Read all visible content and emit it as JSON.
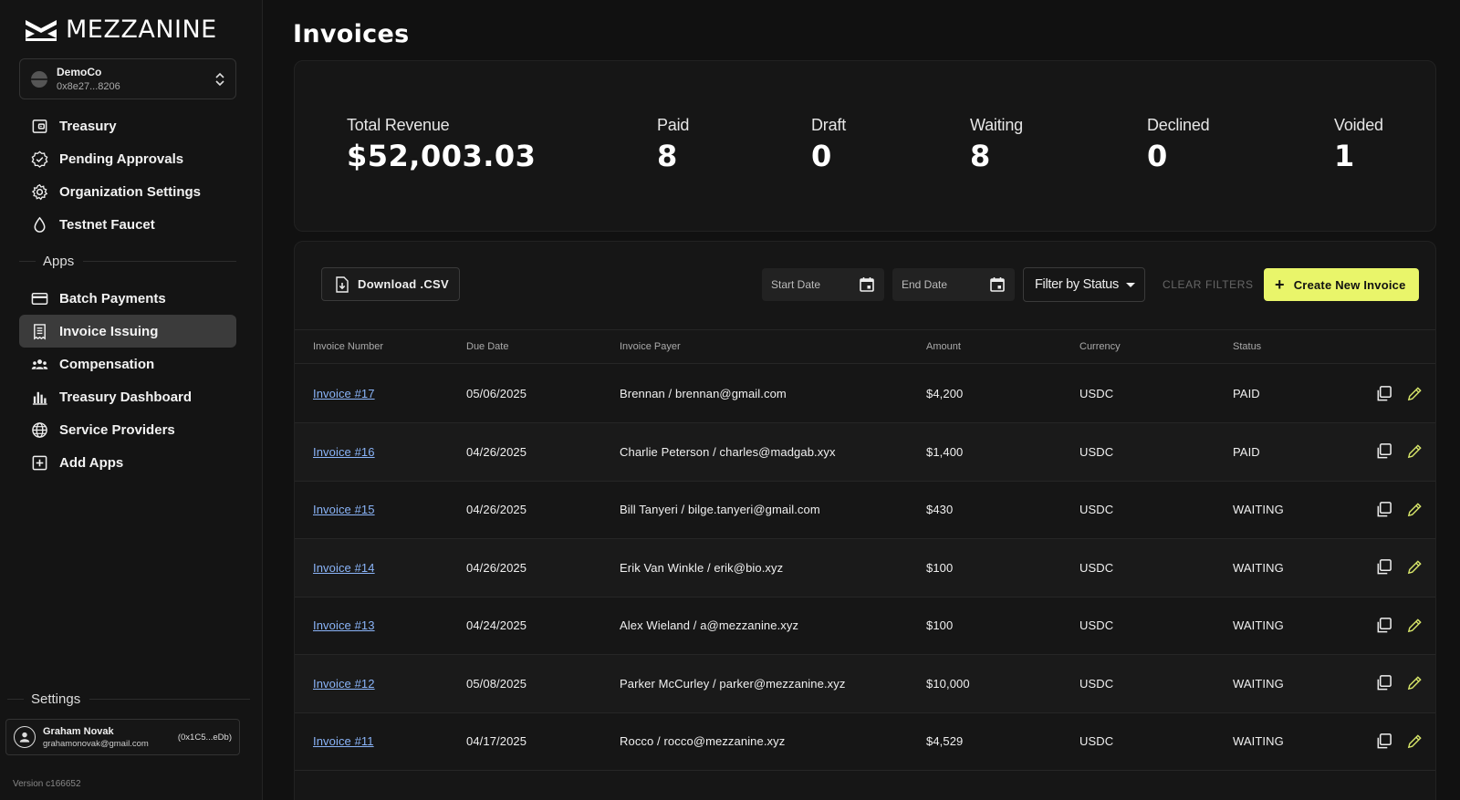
{
  "brand": {
    "name": "MEZZANINE"
  },
  "org": {
    "name": "DemoCo",
    "address": "0x8e27...8206"
  },
  "nav_main": [
    {
      "label": "Treasury",
      "icon": "wallet-icon"
    },
    {
      "label": "Pending Approvals",
      "icon": "approval-badge-icon"
    },
    {
      "label": "Organization Settings",
      "icon": "gear-icon"
    },
    {
      "label": "Testnet Faucet",
      "icon": "droplet-icon"
    }
  ],
  "apps_heading": "Apps",
  "nav_apps": [
    {
      "label": "Batch Payments",
      "icon": "credit-card-icon",
      "active": false
    },
    {
      "label": "Invoice Issuing",
      "icon": "receipt-icon",
      "active": true
    },
    {
      "label": "Compensation",
      "icon": "group-icon",
      "active": false
    },
    {
      "label": "Treasury Dashboard",
      "icon": "bar-chart-icon",
      "active": false
    },
    {
      "label": "Service Providers",
      "icon": "globe-icon",
      "active": false
    },
    {
      "label": "Add Apps",
      "icon": "plus-square-icon",
      "active": false
    }
  ],
  "settings_heading": "Settings",
  "user": {
    "name": "Graham Novak",
    "email": "grahamonovak@gmail.com",
    "wallet": "(0x1C5...eDb)"
  },
  "version": "Version c166652",
  "page_title": "Invoices",
  "stats": {
    "total_revenue": {
      "label": "Total Revenue",
      "value": "$52,003.03"
    },
    "paid": {
      "label": "Paid",
      "value": "8"
    },
    "draft": {
      "label": "Draft",
      "value": "0"
    },
    "waiting": {
      "label": "Waiting",
      "value": "8"
    },
    "declined": {
      "label": "Declined",
      "value": "0"
    },
    "voided": {
      "label": "Voided",
      "value": "1"
    }
  },
  "toolbar": {
    "download_label": "Download .CSV",
    "start_date_placeholder": "Start Date",
    "end_date_placeholder": "End Date",
    "status_filter_label": "Filter by Status",
    "clear_filters_label": "CLEAR FILTERS",
    "create_label": "Create New Invoice"
  },
  "table": {
    "columns": [
      "Invoice Number",
      "Due Date",
      "Invoice Payer",
      "Amount",
      "Currency",
      "Status"
    ],
    "rows": [
      {
        "invoice": "Invoice #17",
        "due": "05/06/2025",
        "payer": "Brennan / brennan@gmail.com",
        "amount": "$4,200",
        "currency": "USDC",
        "status": "PAID"
      },
      {
        "invoice": "Invoice #16",
        "due": "04/26/2025",
        "payer": "Charlie Peterson / charles@madgab.xyx",
        "amount": "$1,400",
        "currency": "USDC",
        "status": "PAID"
      },
      {
        "invoice": "Invoice #15",
        "due": "04/26/2025",
        "payer": "Bill Tanyeri / bilge.tanyeri@gmail.com",
        "amount": "$430",
        "currency": "USDC",
        "status": "WAITING"
      },
      {
        "invoice": "Invoice #14",
        "due": "04/26/2025",
        "payer": "Erik Van Winkle / erik@bio.xyz",
        "amount": "$100",
        "currency": "USDC",
        "status": "WAITING"
      },
      {
        "invoice": "Invoice #13",
        "due": "04/24/2025",
        "payer": "Alex Wieland / a@mezzanine.xyz",
        "amount": "$100",
        "currency": "USDC",
        "status": "WAITING"
      },
      {
        "invoice": "Invoice #12",
        "due": "05/08/2025",
        "payer": "Parker McCurley / parker@mezzanine.xyz",
        "amount": "$10,000",
        "currency": "USDC",
        "status": "WAITING"
      },
      {
        "invoice": "Invoice #11",
        "due": "04/17/2025",
        "payer": "Rocco / rocco@mezzanine.xyz",
        "amount": "$4,529",
        "currency": "USDC",
        "status": "WAITING"
      }
    ]
  },
  "colors": {
    "accent": "#e9f56a",
    "link": "#8ab4f8",
    "edit_icon": "#d8e66a"
  }
}
